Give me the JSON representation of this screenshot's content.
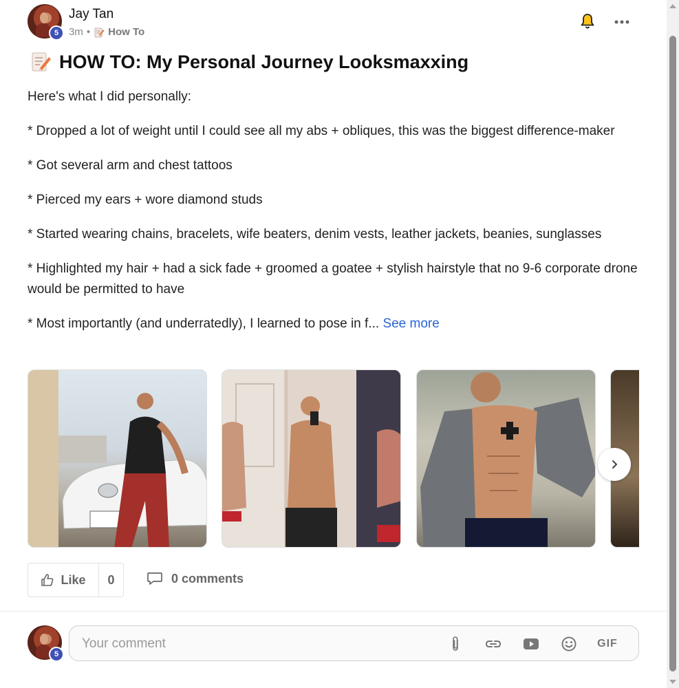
{
  "post": {
    "author": "Jay Tan",
    "level_badge": "5",
    "time_ago": "3m",
    "separator": "•",
    "category": "How To",
    "title": "HOW TO: My Personal Journey Looksmaxxing",
    "paragraphs": [
      "Here's what I did personally:",
      "* Dropped a lot of weight until I could see all my abs + obliques, this was the biggest difference-maker",
      "* Got several arm and chest tattoos",
      "* Pierced my ears + wore diamond studs",
      "* Started wearing chains, bracelets, wife beaters, denim vests, leather jackets, beanies, sunglasses",
      "* Highlighted my hair + had a sick fade + groomed a goatee + stylish hairstyle that no 9-6 corporate drone would be permitted to have"
    ],
    "truncated_paragraph": "* Most importantly (and underratedly), I learned to pose in f...",
    "see_more_label": "See more",
    "photos": [
      "photo-car",
      "photo-mirror-selfie",
      "photo-open-hoodie",
      "photo-partial"
    ],
    "like_label": "Like",
    "like_count": "0",
    "comments_label": "0 comments"
  },
  "comment_bar": {
    "placeholder": "Your comment",
    "gif_label": "GIF",
    "commenter_badge": "5"
  },
  "icons": {
    "bell": "bell-icon",
    "more": "more-horizontal-icon",
    "category": "pencil-memo-icon",
    "next": "chevron-right-icon",
    "like": "thumbs-up-icon",
    "comment": "speech-bubble-icon",
    "attach": "paperclip-icon",
    "link": "link-icon",
    "video": "youtube-icon",
    "emoji": "smiley-icon"
  },
  "colors": {
    "accent_link": "#2a64d8",
    "badge": "#3e51b5",
    "muted_text": "#666666"
  }
}
